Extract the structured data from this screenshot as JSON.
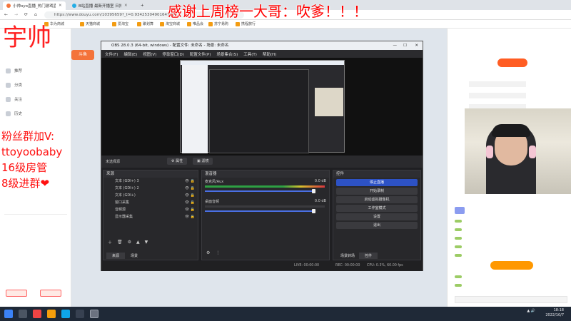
{
  "browser": {
    "tabs": [
      {
        "label": "小帅oyo直播_热门游戏直播_斗鱼"
      },
      {
        "label": "B站直播 最新开播室 日排播号_哔"
      },
      {
        "label": ""
      }
    ],
    "url": "https://www.douyu.com/10395659?_t=0.93425304901647224",
    "bookmarks": [
      "华为商城",
      "天猫商城",
      "爱淘宝",
      "聚划算",
      "淘宝商城",
      "唯品会",
      "苏宁易购",
      "携程旅行"
    ]
  },
  "overlay": {
    "top_caption": "感谢上周榜一大哥：吹爹！！！",
    "handle": "宇帅",
    "fan_lines": [
      "粉丝群加V:",
      "ttoyoobaby",
      "16级房管",
      "8级进群❤"
    ]
  },
  "douyu": {
    "sidebar_items": [
      "推荐",
      "分类",
      "关注",
      "历史"
    ],
    "logo_text": "斗鱼"
  },
  "obs": {
    "title": "OBS 28.0.3 (64-bit, windows) - 配置文件: 未命名 - 场景: 未命名",
    "menu": [
      "文件(F)",
      "编辑(E)",
      "视图(V)",
      "停靠窗口(D)",
      "配置文件(P)",
      "场景集合(S)",
      "工具(T)",
      "帮助(H)"
    ],
    "no_source": "未选择源",
    "props_label": "属性",
    "filters_label": "滤镜",
    "sources_title": "来源",
    "sources": [
      "文本 (GDI+) 3",
      "文本 (GDI+) 2",
      "文本 (GDI+)",
      "窗口采集",
      "音频源",
      "显示器采集"
    ],
    "scenes_tab": "来源",
    "scenes_label": "场景",
    "mixer_title": "混音器",
    "mixer_tracks": [
      {
        "name": "麦克风/Aux",
        "db": "0.0 dB",
        "level": 0.65
      },
      {
        "name": "桌面音频",
        "db": "0.0 dB",
        "level": 0.0
      }
    ],
    "controls_title": "控件",
    "controls": [
      "停止直播",
      "开始录制",
      "启动虚拟摄像机",
      "工作室模式",
      "设置",
      "退出"
    ],
    "transition_tab": "场景转场",
    "controls_tab": "控件",
    "status": {
      "live": "LIVE: 00:00:00",
      "rec": "REC: 00:00:00",
      "cpu": "CPU: 0.3%, 60.00 fps"
    }
  },
  "taskbar": {
    "time": "18:18",
    "date": "2022/10/7"
  }
}
